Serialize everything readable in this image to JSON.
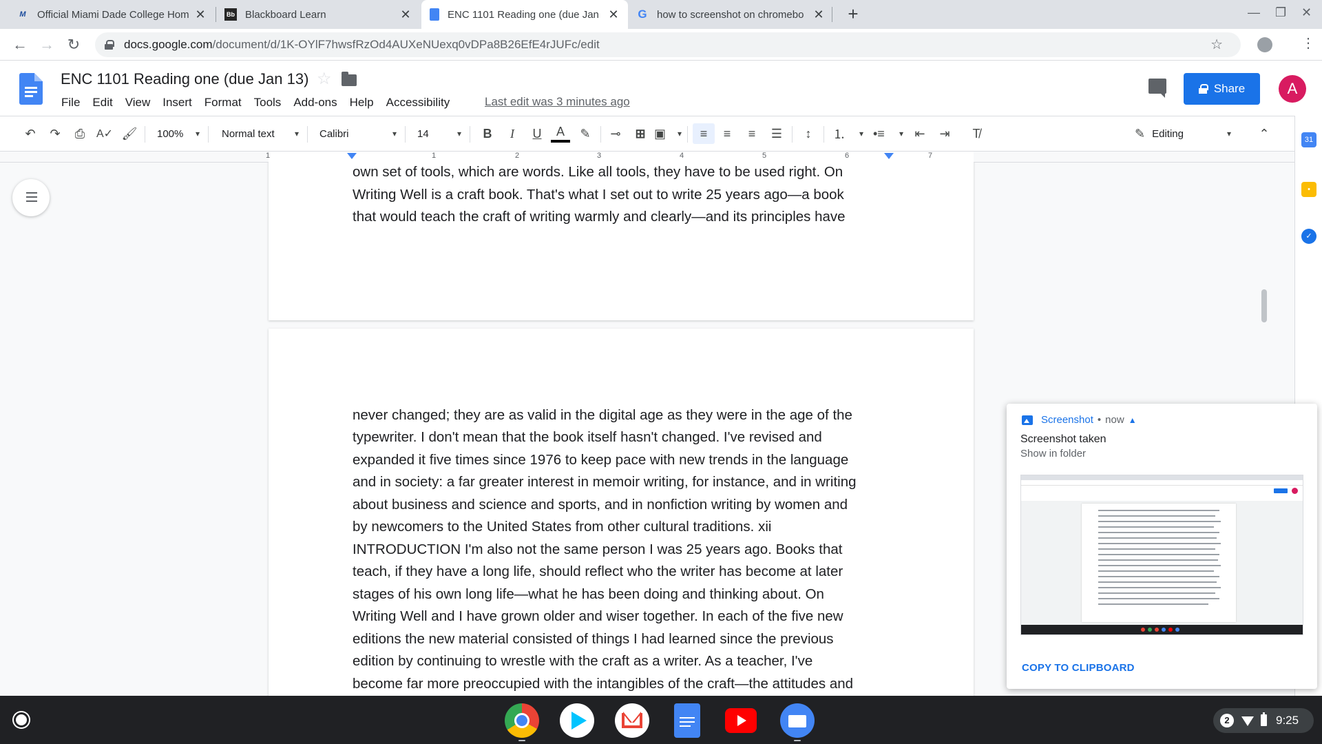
{
  "browser": {
    "tabs": [
      {
        "title": "Official Miami Dade College Hom",
        "icon": "mdc-logo-icon"
      },
      {
        "title": "Blackboard Learn",
        "icon": "blackboard-icon"
      },
      {
        "title": "ENC 1101 Reading one (due Jan",
        "icon": "docs-icon",
        "active": true
      },
      {
        "title": "how to screenshot on chromebo",
        "icon": "google-g-icon"
      }
    ],
    "url_host": "docs.google.com",
    "url_path": "/document/d/1K-OYlF7hwsfRzOd4AUXeNUexq0vDPa8B26EfE4rJUFc/edit"
  },
  "docs": {
    "title": "ENC 1101 Reading one (due Jan 13)",
    "menu": [
      "File",
      "Edit",
      "View",
      "Insert",
      "Format",
      "Tools",
      "Add-ons",
      "Help",
      "Accessibility"
    ],
    "last_edit": "Last edit was 3 minutes ago",
    "share_label": "Share",
    "avatar_initial": "A"
  },
  "toolbar": {
    "zoom": "100%",
    "style": "Normal text",
    "font": "Calibri",
    "font_size": "14",
    "mode": "Editing"
  },
  "ruler": {
    "numbers": [
      "1",
      "1",
      "2",
      "3",
      "4",
      "5",
      "6",
      "7"
    ]
  },
  "document": {
    "page1_lines": [
      "own set of tools, which are words. Like all tools, they have to be used right. On",
      "Writing Well is a craft book. That's what I set out to write 25 years ago—a book",
      "that would teach the craft of writing warmly and clearly—and its principles have"
    ],
    "page2_lines": [
      "never changed; they are as valid in the digital age as they were in the age of the",
      "typewriter. I don't mean that the book itself hasn't changed. I've revised and",
      "expanded it five times since 1976 to keep pace with new trends in the language",
      "and in society: a far greater interest in memoir writing, for instance, and in writing",
      "about business and science and sports, and in nonfiction writing by women and",
      "by newcomers to the United States from other cultural traditions. xii",
      "INTRODUCTION I'm also not the same person I was 25 years ago. Books that",
      "teach, if they have a long life, should reflect who the writer has become at later",
      "stages of his own long life—what he has been doing and thinking about. On",
      "Writing Well and I have grown older and wiser together. In each of the five new",
      "editions the new material consisted of things I had learned since the previous",
      "edition by continuing to wrestle with the craft as a writer. As a teacher, I've",
      "become far more preoccupied with the intangibles of the craft—the attitudes and"
    ]
  },
  "notification": {
    "app": "Screenshot",
    "time": "now",
    "title": "Screenshot taken",
    "subtitle": "Show in folder",
    "action": "COPY TO CLIPBOARD"
  },
  "shelf": {
    "apps": [
      "chrome-icon",
      "play-store-icon",
      "gmail-icon",
      "docs-icon",
      "youtube-icon",
      "files-icon"
    ],
    "notification_count": "2",
    "time": "9:25"
  }
}
